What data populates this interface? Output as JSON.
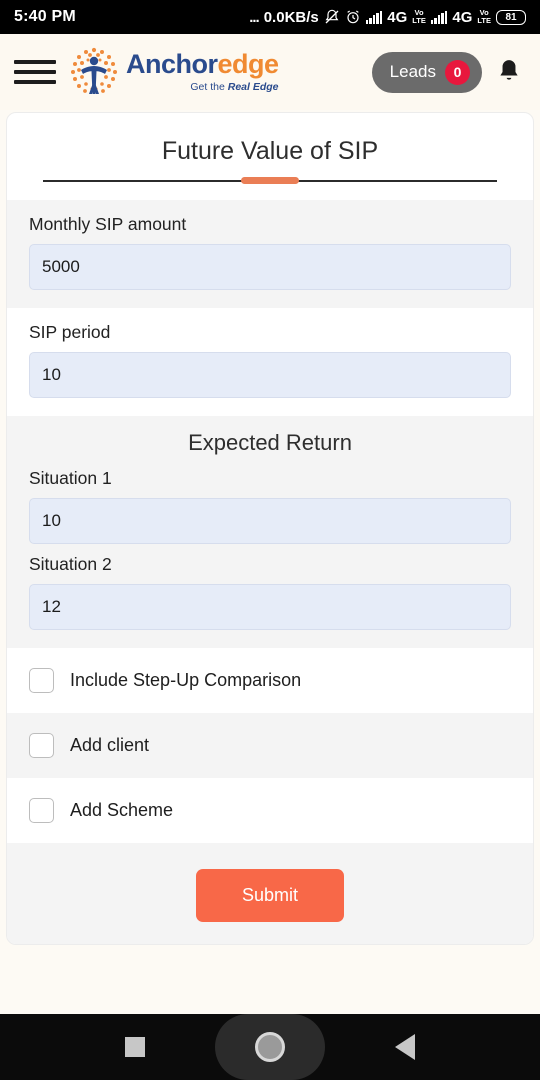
{
  "status_bar": {
    "time": "5:40 PM",
    "network_speed": "0.0KB/s",
    "dots": "...",
    "mute_icon": "bell-slash-icon",
    "alarm_icon": "alarm-clock-icon",
    "sim1_generation": "4G",
    "sim1_volte": "VoLTE",
    "sim2_generation": "4G",
    "sim2_volte": "VoLTE",
    "battery": "81"
  },
  "header": {
    "menu_icon": "hamburger-menu-icon",
    "logo_icon": "anchoredge-logo-icon",
    "brand_first": "Anchor",
    "brand_second": "edge",
    "tagline_prefix": "Get the ",
    "tagline_strong": "Real Edge",
    "leads_label": "Leads",
    "leads_count": "0",
    "bell_icon": "notification-bell-icon",
    "accent_color": "#f08a32",
    "brand_blue": "#2a4b8d"
  },
  "page": {
    "title": "Future Value of SIP"
  },
  "form": {
    "monthly_sip": {
      "label": "Monthly SIP amount",
      "value": "5000",
      "placeholder": "Monthly SIP amount"
    },
    "sip_period": {
      "label": "SIP period",
      "value": "10",
      "placeholder": "SIP period"
    },
    "expected_return": {
      "heading": "Expected Return",
      "situation1": {
        "label": "Situation 1",
        "value": "10",
        "placeholder": "Situation 1"
      },
      "situation2": {
        "label": "Situation 2",
        "value": "12",
        "placeholder": "Situation 2"
      }
    },
    "checkboxes": [
      {
        "label": "Include Step-Up Comparison",
        "checked": false
      },
      {
        "label": "Add client",
        "checked": false
      },
      {
        "label": "Add Scheme",
        "checked": false
      }
    ],
    "submit_label": "Submit",
    "submit_color": "#f86848"
  },
  "nav_bar": {
    "recents_icon": "square-recents-icon",
    "home_icon": "circle-home-icon",
    "back_icon": "triangle-back-icon"
  }
}
